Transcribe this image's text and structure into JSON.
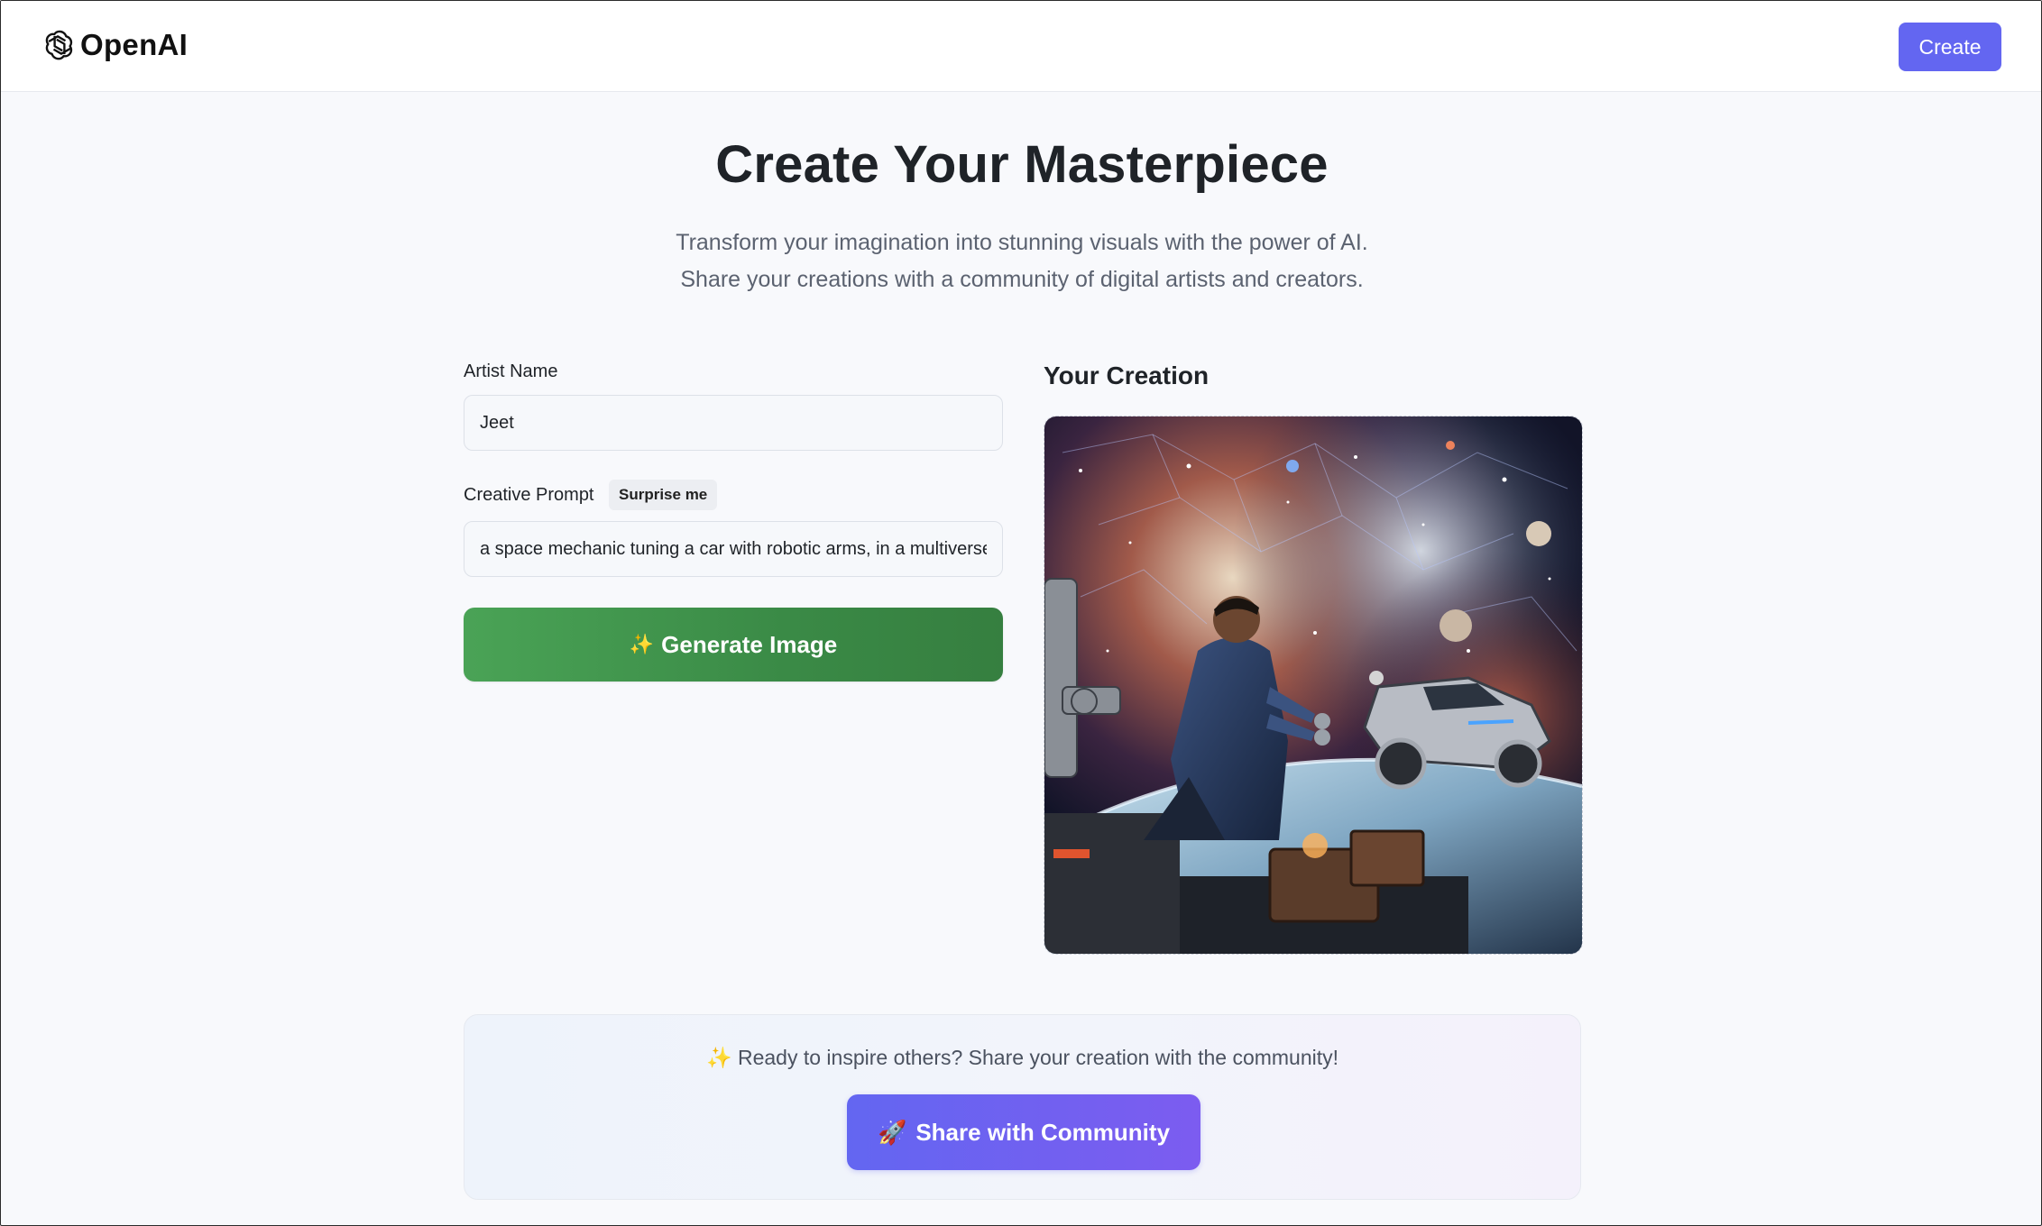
{
  "header": {
    "logo_text": "OpenAI",
    "create_label": "Create"
  },
  "hero": {
    "title": "Create Your Masterpiece",
    "subtitle_line1": "Transform your imagination into stunning visuals with the power of AI.",
    "subtitle_line2": "Share your creations with a community of digital artists and creators."
  },
  "form": {
    "artist_label": "Artist Name",
    "artist_value": "Jeet",
    "prompt_label": "Creative Prompt",
    "surprise_label": "Surprise me",
    "prompt_value": "a space mechanic tuning a car with robotic arms, in a multiverse",
    "generate_icon": "sparkles-icon",
    "generate_label": "Generate Image"
  },
  "creation": {
    "title": "Your Creation"
  },
  "share": {
    "message": "Ready to inspire others? Share your creation with the community!",
    "message_icon": "sparkles-icon",
    "button_icon": "rocket-icon",
    "button_label": "Share with Community"
  },
  "colors": {
    "accent": "#6366f1",
    "generate_green": "#3f9a4c",
    "share_purple": "#7c5cf0",
    "page_bg": "#f8f9fc"
  }
}
